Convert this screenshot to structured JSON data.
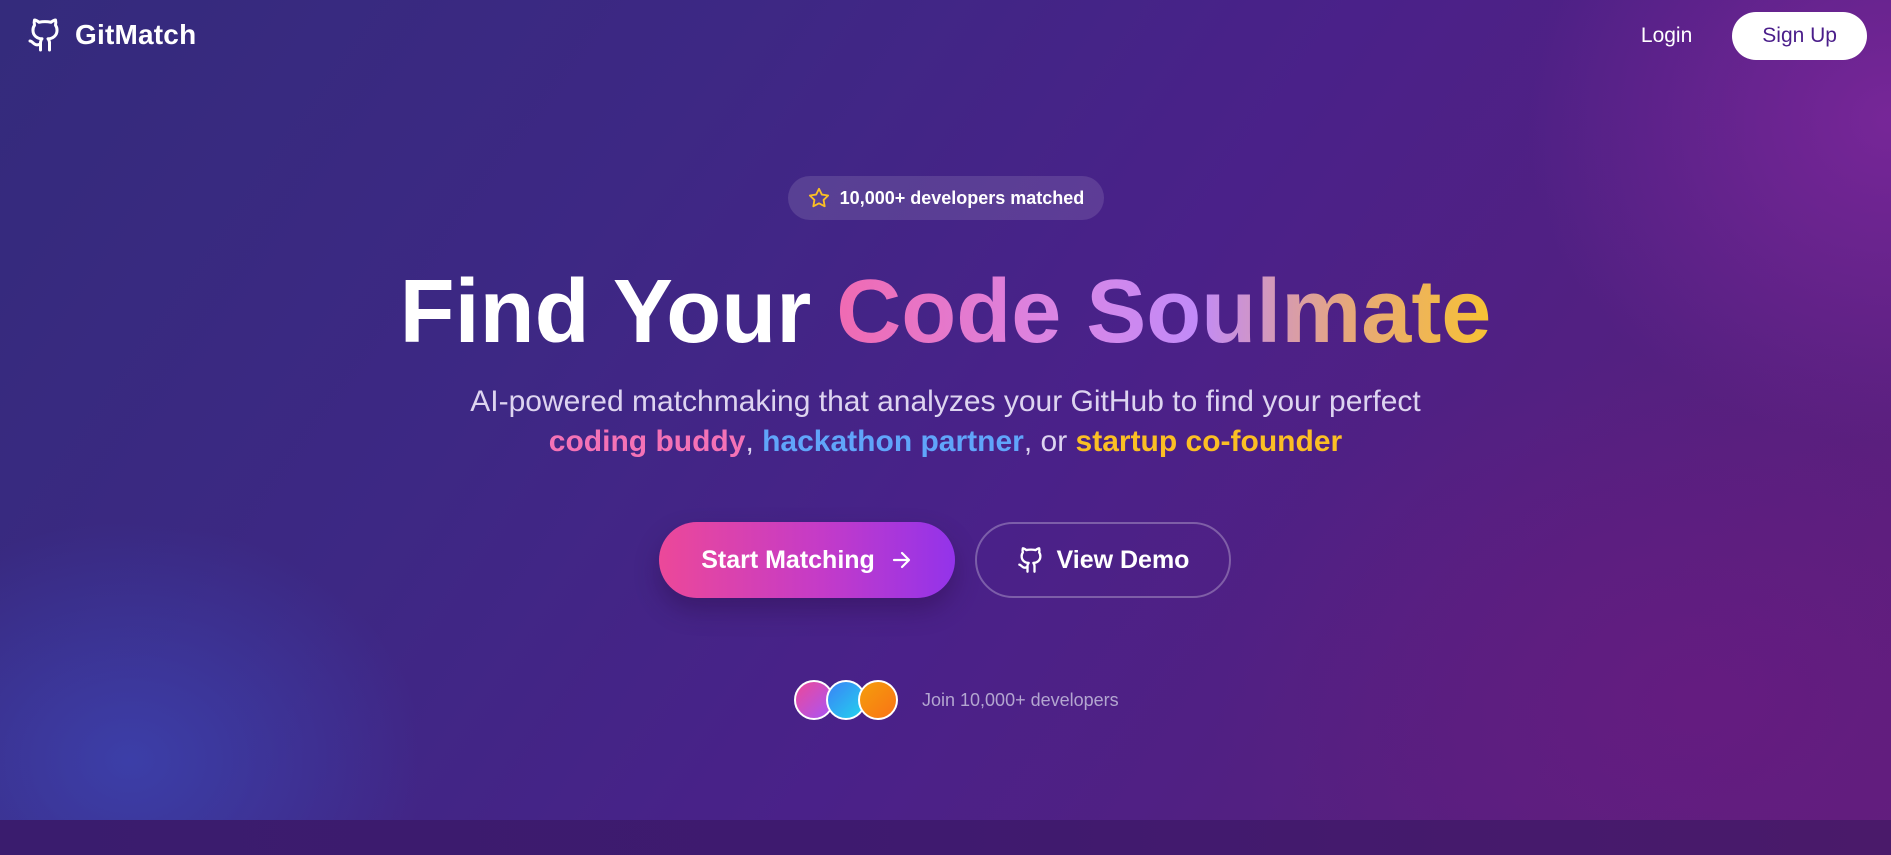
{
  "header": {
    "brand_name": "GitMatch",
    "brand_icon": "github-icon",
    "login_label": "Login",
    "signup_label": "Sign Up"
  },
  "hero": {
    "badge_icon": "star-icon",
    "badge_text": "10,000+ developers matched",
    "title_plain": "Find Your ",
    "title_highlight": "Code Soulmate",
    "subtitle_line1": "AI-powered matchmaking that analyzes your GitHub to find your perfect",
    "subtitle_hl1": "coding buddy",
    "subtitle_sep1": ", ",
    "subtitle_hl2": "hackathon partner",
    "subtitle_sep2": ", or ",
    "subtitle_hl3": "startup co-founder",
    "start_button_label": "Start Matching",
    "start_button_icon": "arrow-right-icon",
    "demo_button_label": "View Demo",
    "demo_button_icon": "github-icon",
    "proof_text": "Join 10,000+ developers"
  },
  "colors": {
    "accent_pink": "#f472b6",
    "accent_blue": "#60a5fa",
    "accent_yellow": "#fbbf24",
    "button_gradient_start": "#ec4899",
    "button_gradient_end": "#9333ea"
  }
}
